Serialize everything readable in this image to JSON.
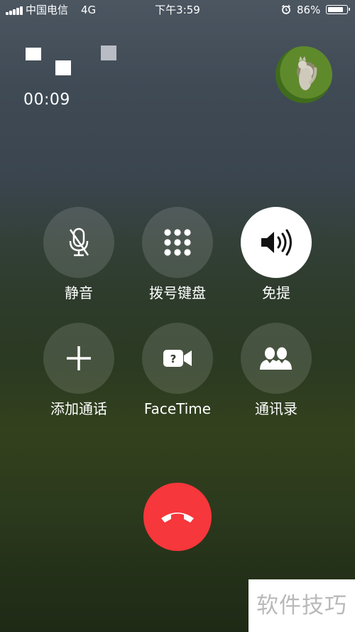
{
  "status_bar": {
    "carrier": "中国电信",
    "network": "4G",
    "time": "下午3:59",
    "battery_percent": "86%",
    "battery_level": 0.86,
    "icons": [
      "signal-bars-icon",
      "alarm-clock-icon",
      "battery-icon"
    ]
  },
  "call": {
    "duration": "00:09"
  },
  "controls": [
    {
      "label": "静音",
      "icon": "mute-mic-icon",
      "active": false
    },
    {
      "label": "拨号键盘",
      "icon": "keypad-icon",
      "active": false
    },
    {
      "label": "免提",
      "icon": "speaker-icon",
      "active": true
    },
    {
      "label": "添加通话",
      "icon": "plus-icon",
      "active": false
    },
    {
      "label": "FaceTime",
      "icon": "facetime-camera-icon",
      "active": false
    },
    {
      "label": "通讯录",
      "icon": "contacts-icon",
      "active": false
    }
  ],
  "end_call": {
    "icon": "hang-up-icon",
    "color": "#f6373b"
  },
  "watermark": "软件技巧",
  "colors": {
    "end_call": "#f6373b",
    "active_button": "#ffffff",
    "inactive_button": "rgba(255,255,255,0.13)"
  }
}
